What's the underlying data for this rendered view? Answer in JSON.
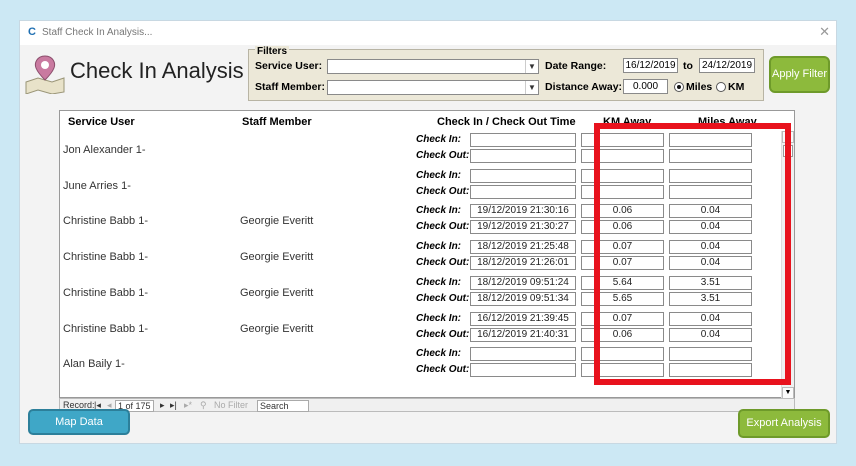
{
  "window": {
    "title": "Staff Check In Analysis...",
    "app_icon": "C"
  },
  "header": {
    "page_title": "Check In Analysis"
  },
  "filters": {
    "legend": "Filters",
    "service_user_label": "Service User:",
    "service_user_value": "",
    "staff_member_label": "Staff Member:",
    "staff_member_value": "",
    "date_range_label": "Date Range:",
    "date_from": "16/12/2019",
    "to_label": "to",
    "date_to": "24/12/2019",
    "distance_away_label": "Distance Away:",
    "distance_value": "0.000",
    "unit_miles_label": "Miles",
    "unit_km_label": "KM",
    "selected_unit": "Miles"
  },
  "apply_filter_label": "Apply Filter",
  "grid": {
    "columns": {
      "service_user": "Service User",
      "staff_member": "Staff Member",
      "check_times": "Check In / Check Out Time",
      "km_away": "KM Away",
      "miles_away": "Miles Away"
    },
    "check_in_label": "Check In:",
    "check_out_label": "Check Out:",
    "rows": [
      {
        "service_user": "Jon Alexander 1-",
        "staff_member": "",
        "check_in": "",
        "check_out": "",
        "km_in": "",
        "km_out": "",
        "mi_in": "",
        "mi_out": ""
      },
      {
        "service_user": "June Arries 1-",
        "staff_member": "",
        "check_in": "",
        "check_out": "",
        "km_in": "",
        "km_out": "",
        "mi_in": "",
        "mi_out": ""
      },
      {
        "service_user": "Christine Babb 1-",
        "staff_member": "Georgie Everitt",
        "check_in": "19/12/2019 21:30:16",
        "check_out": "19/12/2019 21:30:27",
        "km_in": "0.06",
        "km_out": "0.06",
        "mi_in": "0.04",
        "mi_out": "0.04"
      },
      {
        "service_user": "Christine Babb 1-",
        "staff_member": "Georgie Everitt",
        "check_in": "18/12/2019 21:25:48",
        "check_out": "18/12/2019 21:26:01",
        "km_in": "0.07",
        "km_out": "0.07",
        "mi_in": "0.04",
        "mi_out": "0.04"
      },
      {
        "service_user": "Christine Babb 1-",
        "staff_member": "Georgie Everitt",
        "check_in": "18/12/2019 09:51:24",
        "check_out": "18/12/2019 09:51:34",
        "km_in": "5.64",
        "km_out": "5.65",
        "mi_in": "3.51",
        "mi_out": "3.51"
      },
      {
        "service_user": "Christine Babb 1-",
        "staff_member": "Georgie Everitt",
        "check_in": "16/12/2019 21:39:45",
        "check_out": "16/12/2019 21:40:31",
        "km_in": "0.07",
        "km_out": "0.06",
        "mi_in": "0.04",
        "mi_out": "0.04"
      },
      {
        "service_user": "Alan Baily 1-",
        "staff_member": "",
        "check_in": "",
        "check_out": "",
        "km_in": "",
        "km_out": "",
        "mi_in": "",
        "mi_out": ""
      }
    ]
  },
  "navbar": {
    "record_label": "Record:",
    "first_icon": "first-record-icon",
    "prev_icon": "previous-record-icon",
    "record_position": "1 of 175",
    "next_icon": "next-record-icon",
    "last_icon": "last-record-icon",
    "new_icon": "new-record-icon",
    "filter_label": "No Filter",
    "search_placeholder": "Search"
  },
  "buttons": {
    "map_data": "Map Data",
    "export_analysis": "Export Analysis"
  },
  "colors": {
    "highlight": "#e8121d",
    "green_button": "#8dba3c",
    "blue_button": "#3fa7c7",
    "background": "#cce8f4"
  }
}
